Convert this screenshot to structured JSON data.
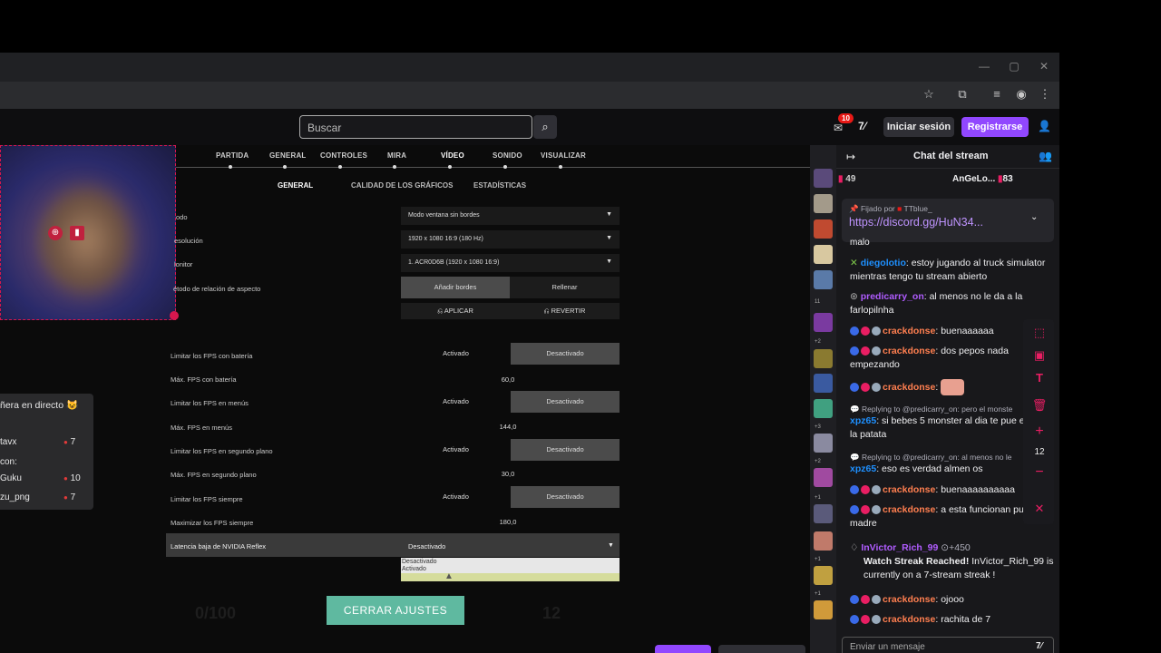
{
  "browser": {
    "icons": [
      "star-icon",
      "extensions-icon",
      "media-icon",
      "account-icon",
      "menu-icon"
    ],
    "window": {
      "minimize": "—",
      "maximize": "▢",
      "close": "✕"
    }
  },
  "header": {
    "search_placeholder": "Buscar",
    "notif_count": "10",
    "login": "Iniciar sesión",
    "signup": "Registrarse"
  },
  "sub_panel": {
    "title": "ñera en directo",
    "emoji": "😺",
    "rows": [
      {
        "name": "tavx",
        "value": "7"
      },
      {
        "name": "con:",
        "value": ""
      },
      {
        "name": "Guku",
        "value": "10"
      },
      {
        "name": "zu_png",
        "value": "7"
      }
    ]
  },
  "settings": {
    "tabs": [
      "PARTIDA",
      "GENERAL",
      "CONTROLES",
      "MIRA",
      "VÍDEO",
      "SONIDO",
      "VISUALIZAR"
    ],
    "active_tab": "VÍDEO",
    "subtabs": [
      "GENERAL",
      "CALIDAD DE LOS GRÁFICOS",
      "ESTADÍSTICAS"
    ],
    "modo": {
      "label": "odo",
      "value": "Modo ventana sin bordes"
    },
    "resolucion": {
      "label": "esolución",
      "value": "1920 x 1080 16:9 (180 Hz)"
    },
    "monitor": {
      "label": "lonitor",
      "value": "1. ACR0D6B (1920 x 1080 16:9)"
    },
    "aspect": {
      "label": "étodo de relación de aspecto",
      "opt1": "Añadir bordes",
      "opt2": "Rellenar"
    },
    "apply": "APLICAR",
    "revert": "REVERTIR",
    "fps_rows": [
      {
        "label": "Limitar los FPS con batería",
        "on": "Activado",
        "off": "Desactivado"
      },
      {
        "label": "Máx. FPS con batería",
        "value": "60,0"
      },
      {
        "label": "Limitar los FPS en menús",
        "on": "Activado",
        "off": "Desactivado"
      },
      {
        "label": "Máx. FPS en menús",
        "value": "144,0"
      },
      {
        "label": "Limitar los FPS en segundo plano",
        "on": "Activado",
        "off": "Desactivado"
      },
      {
        "label": "Máx. FPS en segundo plano",
        "value": "30,0"
      },
      {
        "label": "Limitar los FPS siempre",
        "on": "Activado",
        "off": "Desactivado"
      },
      {
        "label": "Maximizar los FPS siempre",
        "value": "180,0"
      }
    ],
    "nvidia": {
      "label": "Latencia baja de NVIDIA Reflex",
      "value": "Desactivado",
      "options": [
        "Desactivado",
        "Activado"
      ]
    },
    "close": "CERRAR AJUSTES",
    "ghost_left": "0/100",
    "ghost_right": "12"
  },
  "sidebar": {
    "counts": [
      "11",
      "+2",
      "+3",
      "+2",
      "+1",
      "+1",
      "+1",
      "+1"
    ]
  },
  "chat": {
    "title": "Chat del stream",
    "stats": {
      "left": "49",
      "center_name": "AnGeLo...",
      "center_count": "83"
    },
    "pinned": {
      "by_label": "Fijado por",
      "by_user": "TTblue_",
      "link": "https://discord.gg/HuN34..."
    },
    "cut": "malo",
    "messages": [
      {
        "user": "diegolotio",
        "color": "#1e90ff",
        "text": ": estoy jugando al truck simulator mientras tengo tu stream abierto"
      },
      {
        "user": "predicarry_on",
        "color": "#b05cff",
        "text": ": al menos no le da a la farlopilnha"
      },
      {
        "user": "crackdonse",
        "color": "#ff7f50",
        "text": ": buenaaaaaa"
      },
      {
        "user": "crackdonse",
        "color": "#ff7f50",
        "text": ": dos pepos nada empezando"
      },
      {
        "user": "crackdonse",
        "color": "#ff7f50",
        "text": ":"
      },
      {
        "reply": "Replying to @predicarry_on: pero el monste",
        "user": "xpz65",
        "color": "#1e90ff",
        "text": ": si bebes 5 monster al dia te pue explotar la patata"
      },
      {
        "reply": "Replying to @predicarry_on: al menos no le",
        "user": "xpz65",
        "color": "#1e90ff",
        "text": ": eso es verdad almen os"
      },
      {
        "user": "crackdonse",
        "color": "#ff7f50",
        "text": ": buenaaaaaaaaaa"
      },
      {
        "user": "crackdonse",
        "color": "#ff7f50",
        "text": ": a esta funcionan puta madre"
      }
    ],
    "watch_streak": {
      "user": "InVictor_Rich_99",
      "points": "+450",
      "title": "Watch Streak Reached!",
      "text": " InVictor_Rich_99 is currently on a 7-stream streak !"
    },
    "tail": [
      {
        "user": "crackdonse",
        "color": "#ff7f50",
        "text": ": ojooo"
      },
      {
        "user": "crackdonse",
        "color": "#ff7f50",
        "text": ": rachita de 7"
      }
    ],
    "input_placeholder": "Enviar un mensaje",
    "tools_count": "12"
  },
  "colors": {
    "accent": "#9147ff",
    "webcam_border": "#d5174e",
    "close_btn": "#5fb9a0"
  }
}
